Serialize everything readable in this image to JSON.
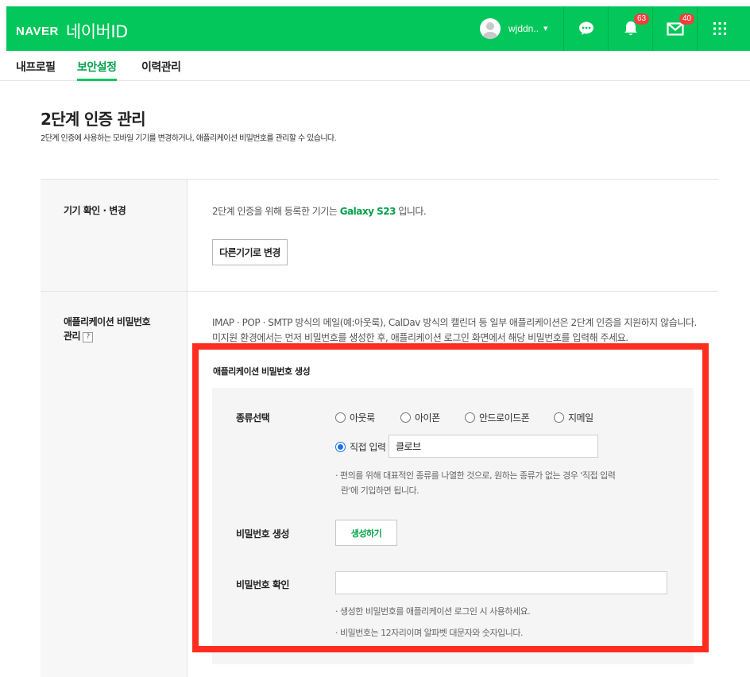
{
  "header": {
    "brand_naver": "NAVER",
    "brand_id": "네이버ID",
    "username": "wjddn..",
    "notification_count": "63",
    "mail_count": "40",
    "colors": {
      "brand_green": "#03c75a",
      "badge_red": "#f0403c"
    },
    "icons": [
      "talk-icon",
      "bell-icon",
      "mail-icon",
      "grid-menu-icon"
    ]
  },
  "tabs": [
    {
      "label": "내프로필"
    },
    {
      "label": "보안설정"
    },
    {
      "label": "이력관리"
    }
  ],
  "page": {
    "title": "2단계 인증 관리",
    "description": "2단계 인증에 사용하는 모바일 기기를 변경하거나, 애플리케이션 비밀번호를 관리할 수 있습니다."
  },
  "device_section": {
    "label": "기기 확인 · 변경",
    "text_before": "2단계 인증을 위해 등록한 기기는 ",
    "device_name": "Galaxy S23",
    "text_after": " 입니다.",
    "change_button": "다른기기로 변경"
  },
  "app_password_section": {
    "label_line1": "애플리케이션 비밀번호",
    "label_line2": "관리",
    "help_icon": "?",
    "info_line1": "IMAP · POP · SMTP 방식의 메일(예:아웃룩), CalDav 방식의 캘린더 등 일부 애플리케이션은 2단계 인증을 지원하지 않습니다.",
    "info_line2": "미지원 환경에서는 먼저 비밀번호를 생성한 후, 애플리케이션 로그인 화면에서 해당 비밀번호를 입력해 주세요.",
    "generate_title": "애플리케이션 비밀번호 생성",
    "type_label": "종류선택",
    "type_options": [
      {
        "label": "아웃룩",
        "checked": false
      },
      {
        "label": "아이폰",
        "checked": false
      },
      {
        "label": "안드로이드폰",
        "checked": false
      },
      {
        "label": "지메일",
        "checked": false
      },
      {
        "label": "직접 입력",
        "checked": true
      }
    ],
    "custom_input_value": "클로브",
    "type_note_line1": "· 편의를 위해 대표적인 종류를 나열한 것으로, 원하는 종류가 없는 경우 '직접 입력",
    "type_note_line2": "란'에 기입하면 됩니다.",
    "password_gen_label": "비밀번호 생성",
    "generate_button": "생성하기",
    "password_confirm_label": "비밀번호 확인",
    "password_confirm_value": "",
    "confirm_note1": "· 생성한 비밀번호를 애플리케이션 로그인 시 사용하세요.",
    "confirm_note2": "· 비밀번호는 12자리이며 알파벳 대문자와 숫자입니다.",
    "highlight_color": "#ff2d1f"
  }
}
